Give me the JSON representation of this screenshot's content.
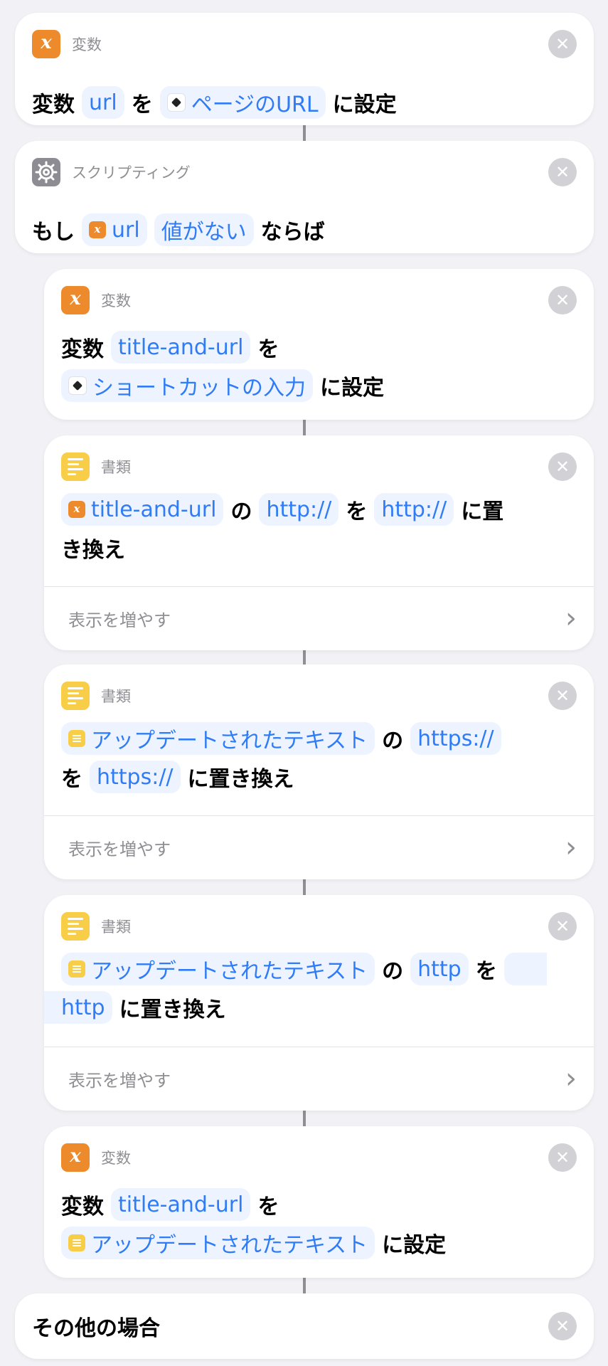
{
  "cards": [
    {
      "category": "変数",
      "line1": {
        "t1": "変数",
        "p1": "url",
        "t2": "を",
        "p2": "ページのURL",
        "t3": "に設定"
      }
    },
    {
      "category": "スクリプティング",
      "line1": {
        "t1": "もし",
        "p1": "url",
        "p2": "値がない",
        "t2": "ならば"
      }
    },
    {
      "category": "変数",
      "line1": {
        "t1": "変数",
        "p1": "title-and-url",
        "t2": "を"
      },
      "line2": {
        "p2": "ショートカットの入力",
        "t3": "に設定"
      }
    },
    {
      "category": "書類",
      "line1": {
        "p1": "title-and-url",
        "t1": "の",
        "p2": "http://",
        "t2": "を",
        "p3": "http://",
        "t3": "に置"
      },
      "line2": {
        "t4": "き換え"
      },
      "more": "表示を増やす"
    },
    {
      "category": "書類",
      "line1": {
        "p1": "アップデートされたテキスト",
        "t1": "の",
        "p2": "https://"
      },
      "line2": {
        "t2": "を",
        "p3": "https://",
        "t3": "に置き換え"
      },
      "more": "表示を増やす"
    },
    {
      "category": "書類",
      "line1": {
        "p1": "アップデートされたテキスト",
        "t1": "の",
        "p2": "http",
        "t2": "を"
      },
      "line2": {
        "p3": "http",
        "t3": "に置き換え"
      },
      "more": "表示を増やす"
    },
    {
      "category": "変数",
      "line1": {
        "t1": "変数",
        "p1": "title-and-url",
        "t2": "を"
      },
      "line2": {
        "p2": "アップデートされたテキスト",
        "t3": "に設定"
      }
    },
    {
      "line1": {
        "t1": "その他の場合"
      }
    }
  ]
}
